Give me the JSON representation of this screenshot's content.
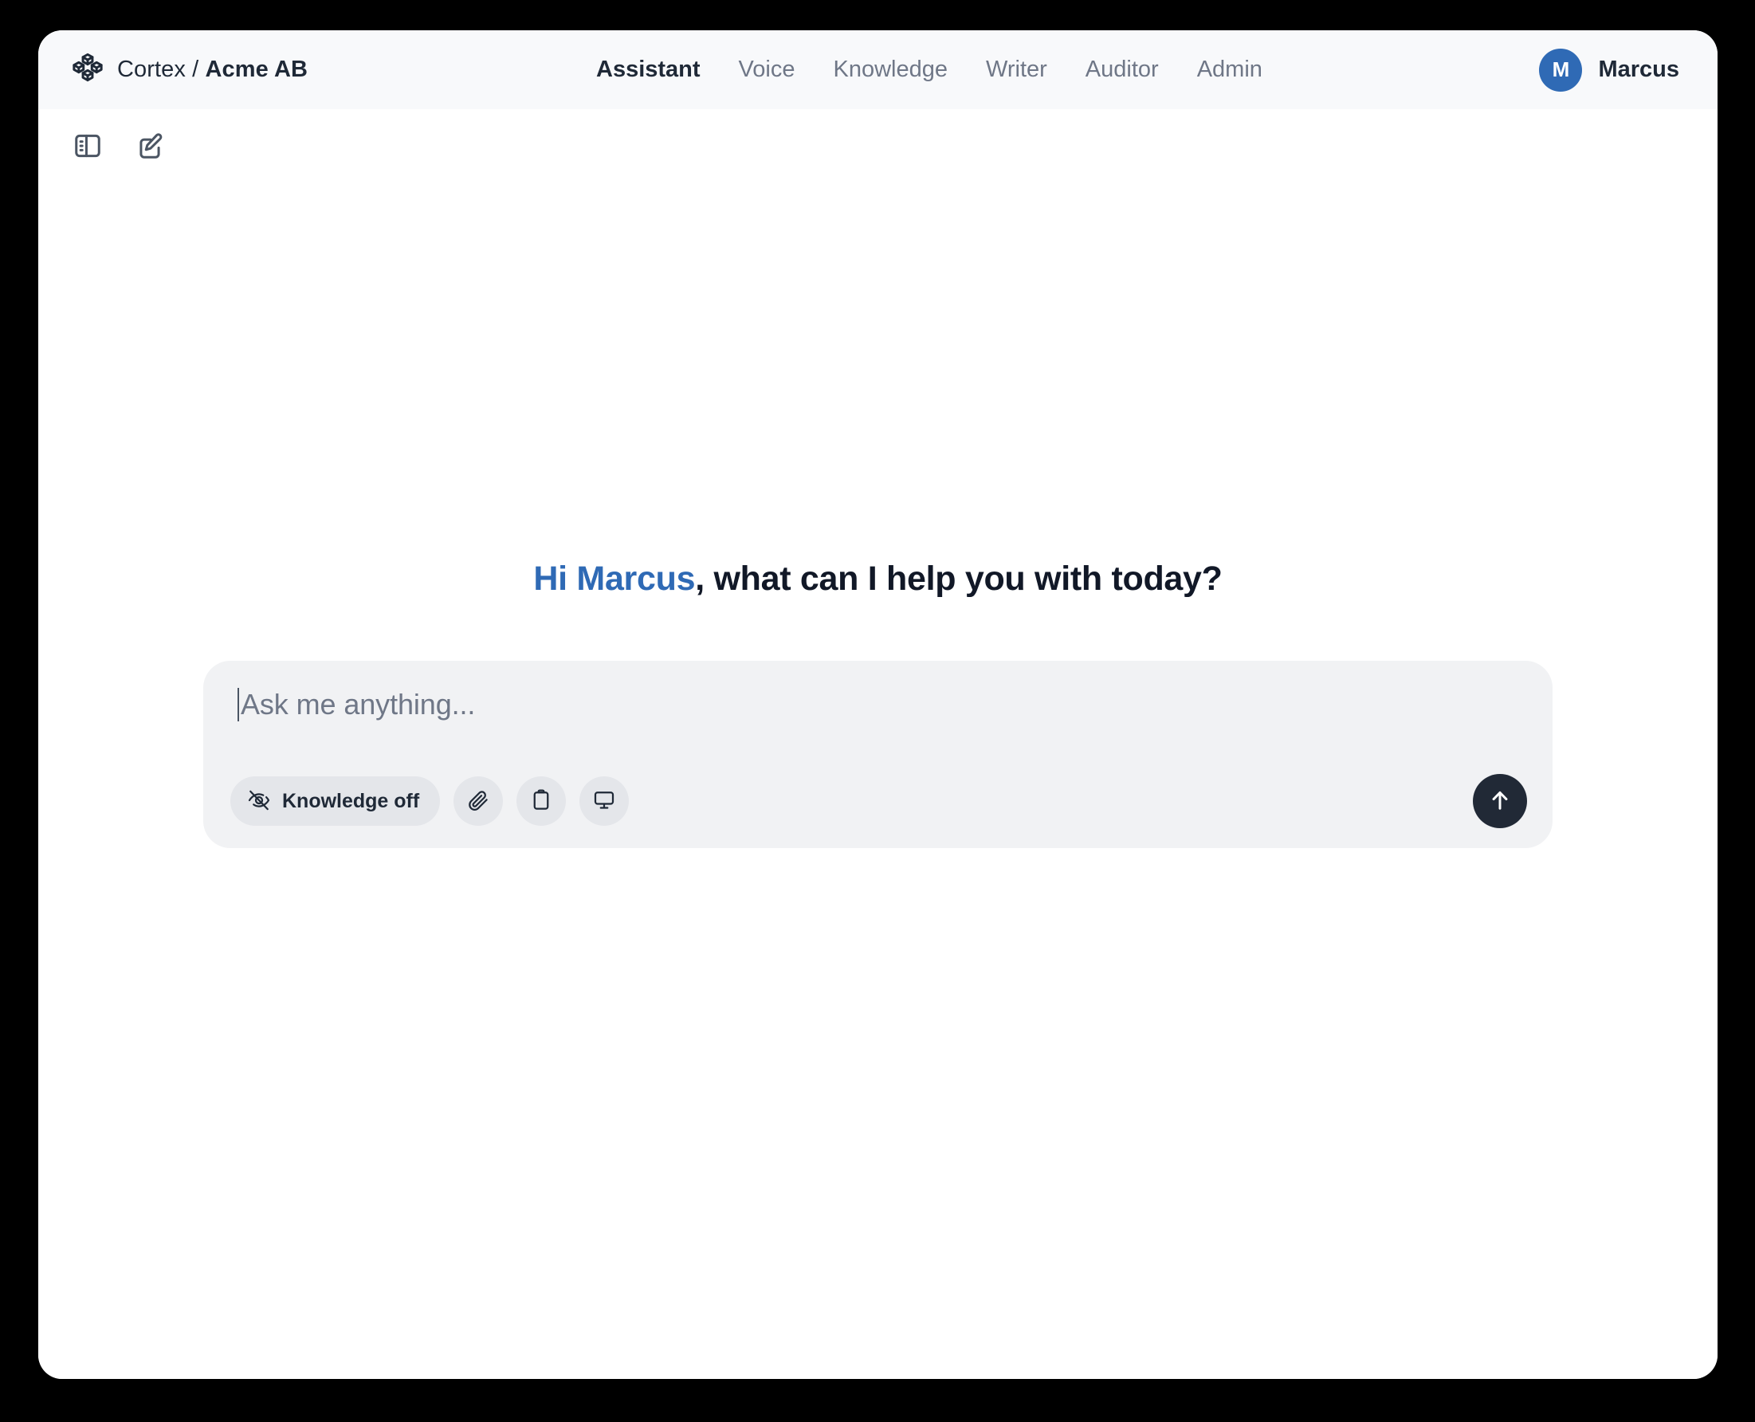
{
  "window": {
    "background_color": "#000000",
    "card_color": "#ffffff"
  },
  "header": {
    "background_color": "#f8f9fb",
    "brand": {
      "icon": "boxes-logo-icon",
      "product": "Cortex",
      "separator": " / ",
      "workspace": "Acme AB"
    },
    "nav": {
      "active_color": "#1f2937",
      "inactive_color": "#6f7787",
      "items": [
        {
          "label": "Assistant",
          "active": true
        },
        {
          "label": "Voice",
          "active": false
        },
        {
          "label": "Knowledge",
          "active": false
        },
        {
          "label": "Writer",
          "active": false
        },
        {
          "label": "Auditor",
          "active": false
        },
        {
          "label": "Admin",
          "active": false
        }
      ]
    },
    "user": {
      "initial": "M",
      "name": "Marcus",
      "avatar_color": "#2f6ab5"
    }
  },
  "toolbar": {
    "buttons": [
      {
        "icon": "sidebar-toggle-icon",
        "label": "Toggle sidebar"
      },
      {
        "icon": "compose-edit-icon",
        "label": "New chat"
      }
    ]
  },
  "main": {
    "greeting": {
      "highlight": "Hi Marcus",
      "rest": ", what can I help you with today?",
      "highlight_color": "#2f6ab5",
      "rest_color": "#111827"
    },
    "composer": {
      "background_color": "#f1f2f4",
      "placeholder": "Ask me anything...",
      "value": "",
      "caret_visible": true,
      "knowledge_toggle": {
        "icon": "eye-off-icon",
        "label": "Knowledge off",
        "state": "off"
      },
      "action_buttons": [
        {
          "icon": "paperclip-icon",
          "label": "Attach file"
        },
        {
          "icon": "clipboard-icon",
          "label": "Paste from clipboard"
        },
        {
          "icon": "monitor-icon",
          "label": "Share screen"
        }
      ],
      "send_button": {
        "icon": "arrow-up-icon",
        "label": "Send",
        "background_color": "#212936"
      }
    }
  }
}
